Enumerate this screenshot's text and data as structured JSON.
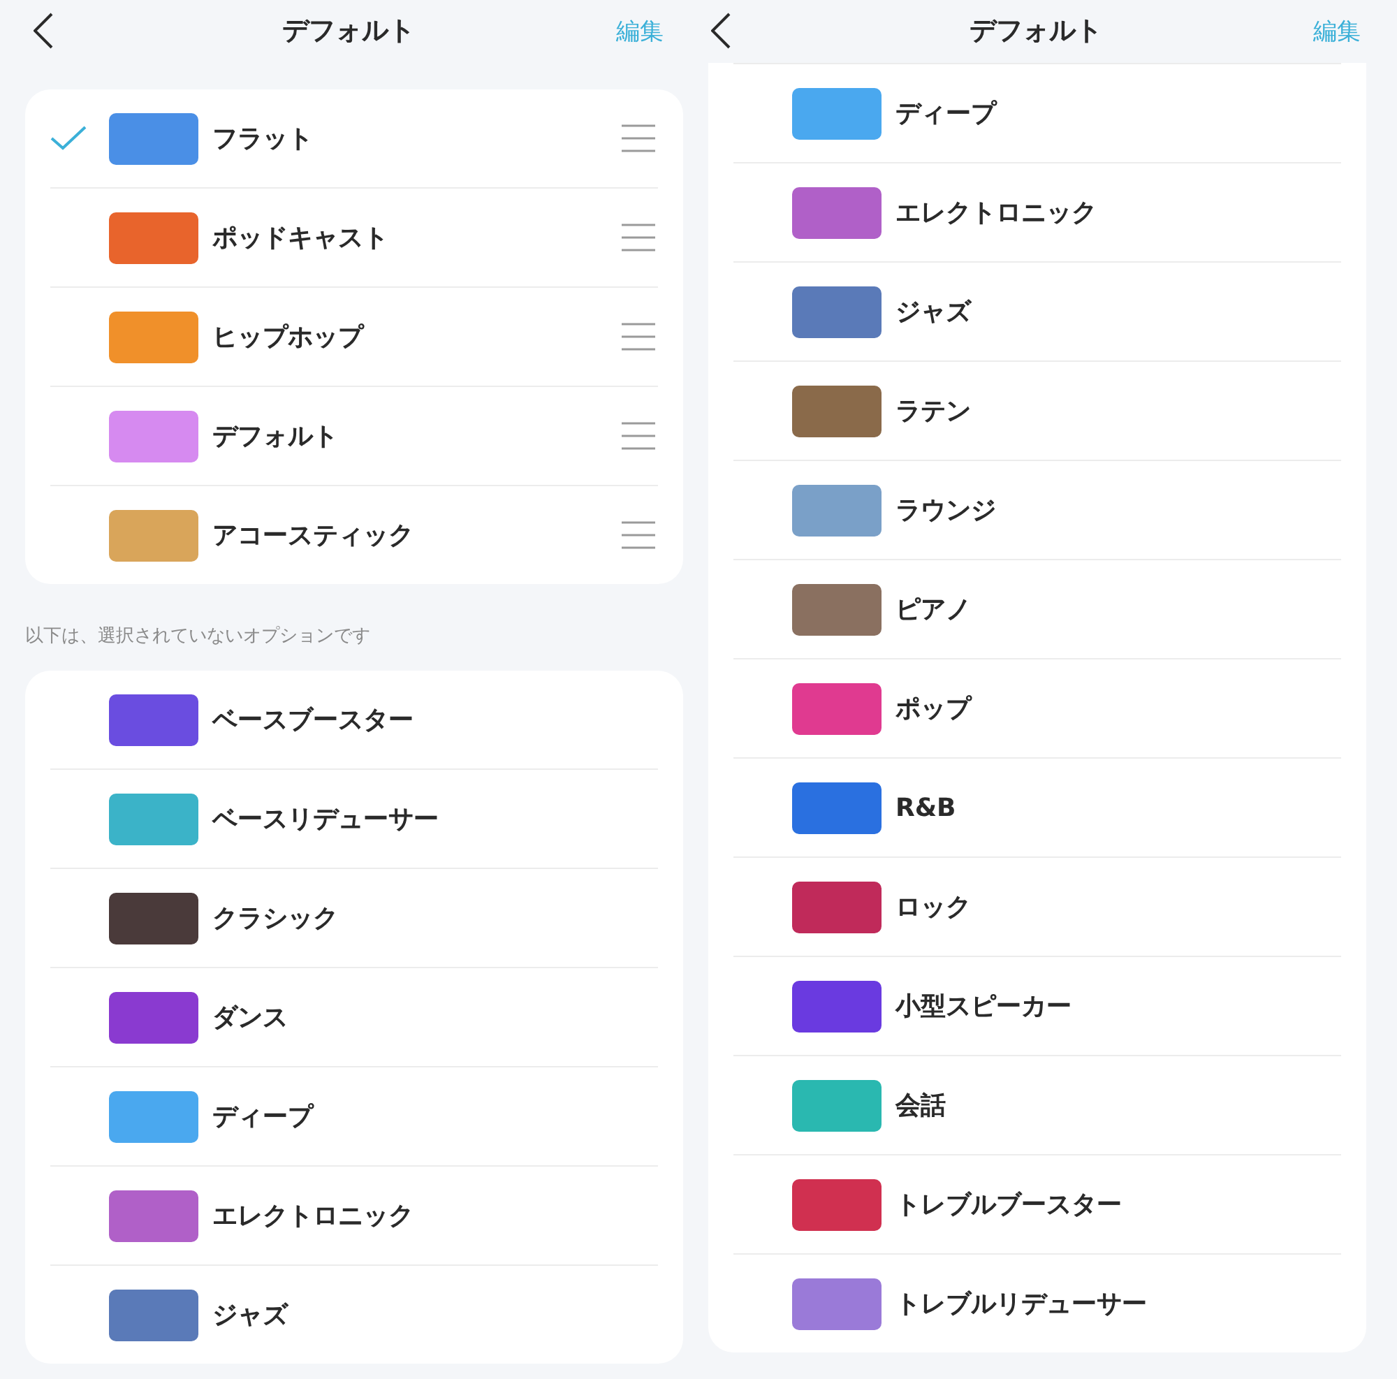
{
  "screens": [
    {
      "header": {
        "title": "デフォルト",
        "action": "編集"
      },
      "scrolled": false,
      "sections": [
        {
          "reorderable": true,
          "items": [
            {
              "name": "フラット",
              "selected": true,
              "color": "#4a8fe6"
            },
            {
              "name": "ポッドキャスト",
              "selected": false,
              "color": "#e8642c"
            },
            {
              "name": "ヒップホップ",
              "selected": false,
              "color": "#f0902a"
            },
            {
              "name": "デフォルト",
              "selected": false,
              "color": "#d68af0"
            },
            {
              "name": "アコースティック",
              "selected": false,
              "color": "#d9a55a"
            }
          ]
        },
        {
          "caption": "以下は、選択されていないオプションです",
          "reorderable": false,
          "items": [
            {
              "name": "ベースブースター",
              "color": "#6a4de0"
            },
            {
              "name": "ベースリデューサー",
              "color": "#3bb3c8"
            },
            {
              "name": "クラシック",
              "color": "#4a3a3a"
            },
            {
              "name": "ダンス",
              "color": "#8a3ad0"
            },
            {
              "name": "ディープ",
              "color": "#4aa8ef"
            },
            {
              "name": "エレクトロニック",
              "color": "#b060c8"
            },
            {
              "name": "ジャズ",
              "color": "#5a7ab8"
            }
          ]
        }
      ]
    },
    {
      "header": {
        "title": "デフォルト",
        "action": "編集"
      },
      "scrolled": true,
      "sections": [
        {
          "reorderable": false,
          "items": [
            {
              "name": "ディープ",
              "color": "#4aa8ef"
            },
            {
              "name": "エレクトロニック",
              "color": "#b060c8"
            },
            {
              "name": "ジャズ",
              "color": "#5a7ab8"
            },
            {
              "name": "ラテン",
              "color": "#8a6a4a"
            },
            {
              "name": "ラウンジ",
              "color": "#7aa0c8"
            },
            {
              "name": "ピアノ",
              "color": "#8a7060"
            },
            {
              "name": "ポップ",
              "color": "#e03a90"
            },
            {
              "name": "R&B",
              "color": "#2a70e0"
            },
            {
              "name": "ロック",
              "color": "#c02a5a"
            },
            {
              "name": "小型スピーカー",
              "color": "#6a3ae0"
            },
            {
              "name": "会話",
              "color": "#2ab8b0"
            },
            {
              "name": "トレブルブースター",
              "color": "#d03050"
            },
            {
              "name": "トレブルリデューサー",
              "color": "#9a7ad8"
            }
          ]
        }
      ]
    }
  ]
}
